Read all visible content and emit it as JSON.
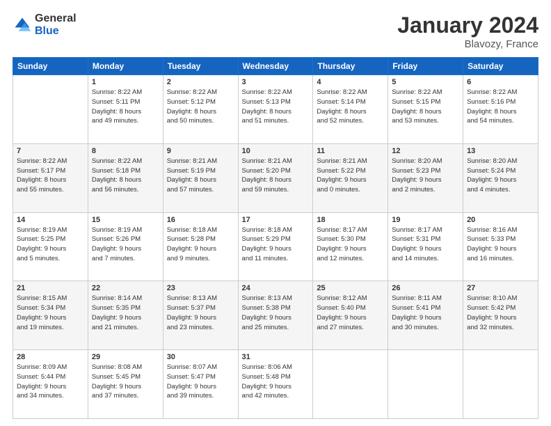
{
  "header": {
    "logo_general": "General",
    "logo_blue": "Blue",
    "month_title": "January 2024",
    "location": "Blavozy, France"
  },
  "columns": [
    "Sunday",
    "Monday",
    "Tuesday",
    "Wednesday",
    "Thursday",
    "Friday",
    "Saturday"
  ],
  "weeks": [
    [
      {
        "day": "",
        "info": ""
      },
      {
        "day": "1",
        "info": "Sunrise: 8:22 AM\nSunset: 5:11 PM\nDaylight: 8 hours\nand 49 minutes."
      },
      {
        "day": "2",
        "info": "Sunrise: 8:22 AM\nSunset: 5:12 PM\nDaylight: 8 hours\nand 50 minutes."
      },
      {
        "day": "3",
        "info": "Sunrise: 8:22 AM\nSunset: 5:13 PM\nDaylight: 8 hours\nand 51 minutes."
      },
      {
        "day": "4",
        "info": "Sunrise: 8:22 AM\nSunset: 5:14 PM\nDaylight: 8 hours\nand 52 minutes."
      },
      {
        "day": "5",
        "info": "Sunrise: 8:22 AM\nSunset: 5:15 PM\nDaylight: 8 hours\nand 53 minutes."
      },
      {
        "day": "6",
        "info": "Sunrise: 8:22 AM\nSunset: 5:16 PM\nDaylight: 8 hours\nand 54 minutes."
      }
    ],
    [
      {
        "day": "7",
        "info": "Sunrise: 8:22 AM\nSunset: 5:17 PM\nDaylight: 8 hours\nand 55 minutes."
      },
      {
        "day": "8",
        "info": "Sunrise: 8:22 AM\nSunset: 5:18 PM\nDaylight: 8 hours\nand 56 minutes."
      },
      {
        "day": "9",
        "info": "Sunrise: 8:21 AM\nSunset: 5:19 PM\nDaylight: 8 hours\nand 57 minutes."
      },
      {
        "day": "10",
        "info": "Sunrise: 8:21 AM\nSunset: 5:20 PM\nDaylight: 8 hours\nand 59 minutes."
      },
      {
        "day": "11",
        "info": "Sunrise: 8:21 AM\nSunset: 5:22 PM\nDaylight: 9 hours\nand 0 minutes."
      },
      {
        "day": "12",
        "info": "Sunrise: 8:20 AM\nSunset: 5:23 PM\nDaylight: 9 hours\nand 2 minutes."
      },
      {
        "day": "13",
        "info": "Sunrise: 8:20 AM\nSunset: 5:24 PM\nDaylight: 9 hours\nand 4 minutes."
      }
    ],
    [
      {
        "day": "14",
        "info": "Sunrise: 8:19 AM\nSunset: 5:25 PM\nDaylight: 9 hours\nand 5 minutes."
      },
      {
        "day": "15",
        "info": "Sunrise: 8:19 AM\nSunset: 5:26 PM\nDaylight: 9 hours\nand 7 minutes."
      },
      {
        "day": "16",
        "info": "Sunrise: 8:18 AM\nSunset: 5:28 PM\nDaylight: 9 hours\nand 9 minutes."
      },
      {
        "day": "17",
        "info": "Sunrise: 8:18 AM\nSunset: 5:29 PM\nDaylight: 9 hours\nand 11 minutes."
      },
      {
        "day": "18",
        "info": "Sunrise: 8:17 AM\nSunset: 5:30 PM\nDaylight: 9 hours\nand 12 minutes."
      },
      {
        "day": "19",
        "info": "Sunrise: 8:17 AM\nSunset: 5:31 PM\nDaylight: 9 hours\nand 14 minutes."
      },
      {
        "day": "20",
        "info": "Sunrise: 8:16 AM\nSunset: 5:33 PM\nDaylight: 9 hours\nand 16 minutes."
      }
    ],
    [
      {
        "day": "21",
        "info": "Sunrise: 8:15 AM\nSunset: 5:34 PM\nDaylight: 9 hours\nand 19 minutes."
      },
      {
        "day": "22",
        "info": "Sunrise: 8:14 AM\nSunset: 5:35 PM\nDaylight: 9 hours\nand 21 minutes."
      },
      {
        "day": "23",
        "info": "Sunrise: 8:13 AM\nSunset: 5:37 PM\nDaylight: 9 hours\nand 23 minutes."
      },
      {
        "day": "24",
        "info": "Sunrise: 8:13 AM\nSunset: 5:38 PM\nDaylight: 9 hours\nand 25 minutes."
      },
      {
        "day": "25",
        "info": "Sunrise: 8:12 AM\nSunset: 5:40 PM\nDaylight: 9 hours\nand 27 minutes."
      },
      {
        "day": "26",
        "info": "Sunrise: 8:11 AM\nSunset: 5:41 PM\nDaylight: 9 hours\nand 30 minutes."
      },
      {
        "day": "27",
        "info": "Sunrise: 8:10 AM\nSunset: 5:42 PM\nDaylight: 9 hours\nand 32 minutes."
      }
    ],
    [
      {
        "day": "28",
        "info": "Sunrise: 8:09 AM\nSunset: 5:44 PM\nDaylight: 9 hours\nand 34 minutes."
      },
      {
        "day": "29",
        "info": "Sunrise: 8:08 AM\nSunset: 5:45 PM\nDaylight: 9 hours\nand 37 minutes."
      },
      {
        "day": "30",
        "info": "Sunrise: 8:07 AM\nSunset: 5:47 PM\nDaylight: 9 hours\nand 39 minutes."
      },
      {
        "day": "31",
        "info": "Sunrise: 8:06 AM\nSunset: 5:48 PM\nDaylight: 9 hours\nand 42 minutes."
      },
      {
        "day": "",
        "info": ""
      },
      {
        "day": "",
        "info": ""
      },
      {
        "day": "",
        "info": ""
      }
    ]
  ]
}
